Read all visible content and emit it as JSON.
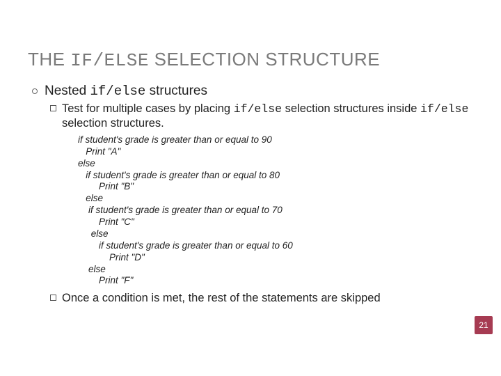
{
  "title": {
    "t1": "T",
    "t2": "HE ",
    "code": "IF/ELSE",
    "t3": " S",
    "t4": "ELECTION ",
    "t5": "S",
    "t6": "TRUCTURE"
  },
  "b1": {
    "pre": "Nested ",
    "code": "if/else",
    "post": " structures"
  },
  "b2a": {
    "p1": "Test for multiple cases by placing ",
    "c1": "if/else",
    "p2": " selection structures inside ",
    "c2": "if/else",
    "p3": " selection structures."
  },
  "pseudo": "if student's grade is greater than or equal to 90\n   Print \"A\"\nelse\n   if student's grade is greater than or equal to 80\n        Print \"B\"\n   else\n    if student's grade is greater than or equal to 70\n        Print \"C\"\n     else\n        if student's grade is greater than or equal to 60\n            Print \"D\"\n    else\n        Print \"F\"",
  "b2b": "Once a condition is met, the rest of the statements are skipped",
  "pagenum": "21"
}
